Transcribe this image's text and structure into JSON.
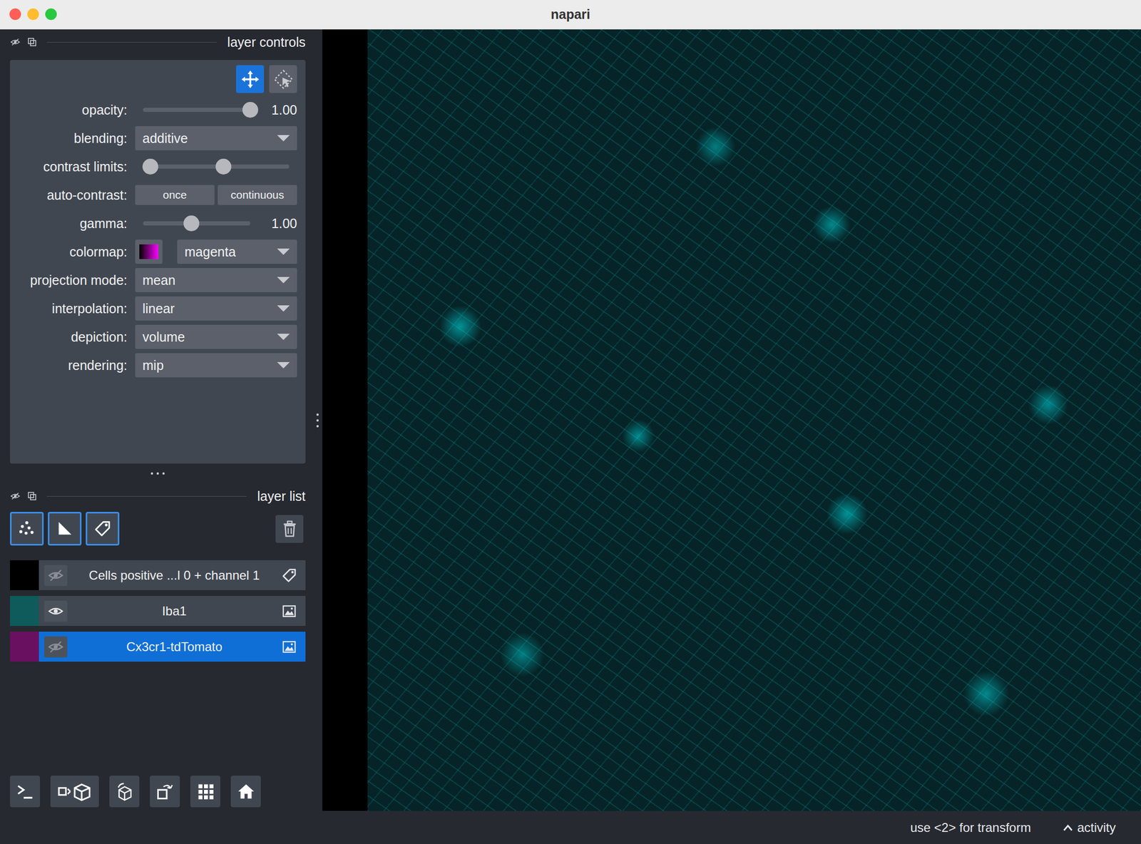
{
  "window": {
    "title": "napari"
  },
  "layer_controls": {
    "header": "layer controls",
    "tools": [
      {
        "kind": "move",
        "selected": true
      },
      {
        "kind": "transform",
        "selected": false
      }
    ],
    "rows": [
      {
        "kind": "slider",
        "label": "opacity:",
        "level": 1,
        "reading": "1.00"
      },
      {
        "kind": "dropdown",
        "label": "blending:",
        "value": "additive"
      },
      {
        "kind": "range",
        "label": "contrast limits:",
        "low": 0.05,
        "high": 0.55
      },
      {
        "kind": "buttons",
        "label": "auto-contrast:",
        "buttons": [
          "once",
          "continuous"
        ]
      },
      {
        "kind": "slider",
        "label": "gamma:",
        "level": 0.45,
        "reading": "1.00"
      },
      {
        "kind": "colormap",
        "label": "colormap:",
        "value": "magenta",
        "color": "#ff00ff"
      },
      {
        "kind": "dropdown",
        "label": "projection mode:",
        "value": "mean"
      },
      {
        "kind": "dropdown",
        "label": "interpolation:",
        "value": "linear"
      },
      {
        "kind": "dropdown",
        "label": "depiction:",
        "value": "volume"
      },
      {
        "kind": "dropdown",
        "label": "rendering:",
        "value": "mip"
      }
    ]
  },
  "layer_list": {
    "header": "layer list",
    "new_layer_buttons": [
      {
        "kind": "points"
      },
      {
        "kind": "shapes"
      },
      {
        "kind": "labels"
      }
    ],
    "layers": [
      {
        "name": "Cells positive ...l 0 + channel 1",
        "kind": "labels",
        "visible": false,
        "selected": false,
        "color": "#000000"
      },
      {
        "name": "Iba1",
        "kind": "image",
        "visible": true,
        "selected": false,
        "color": "#0f5a5a"
      },
      {
        "name": "Cx3cr1-tdTomato",
        "kind": "image",
        "visible": false,
        "selected": true,
        "color": "#6a1060"
      }
    ]
  },
  "status_bar": {
    "hint": "use <2> for transform",
    "activity": "activity"
  }
}
